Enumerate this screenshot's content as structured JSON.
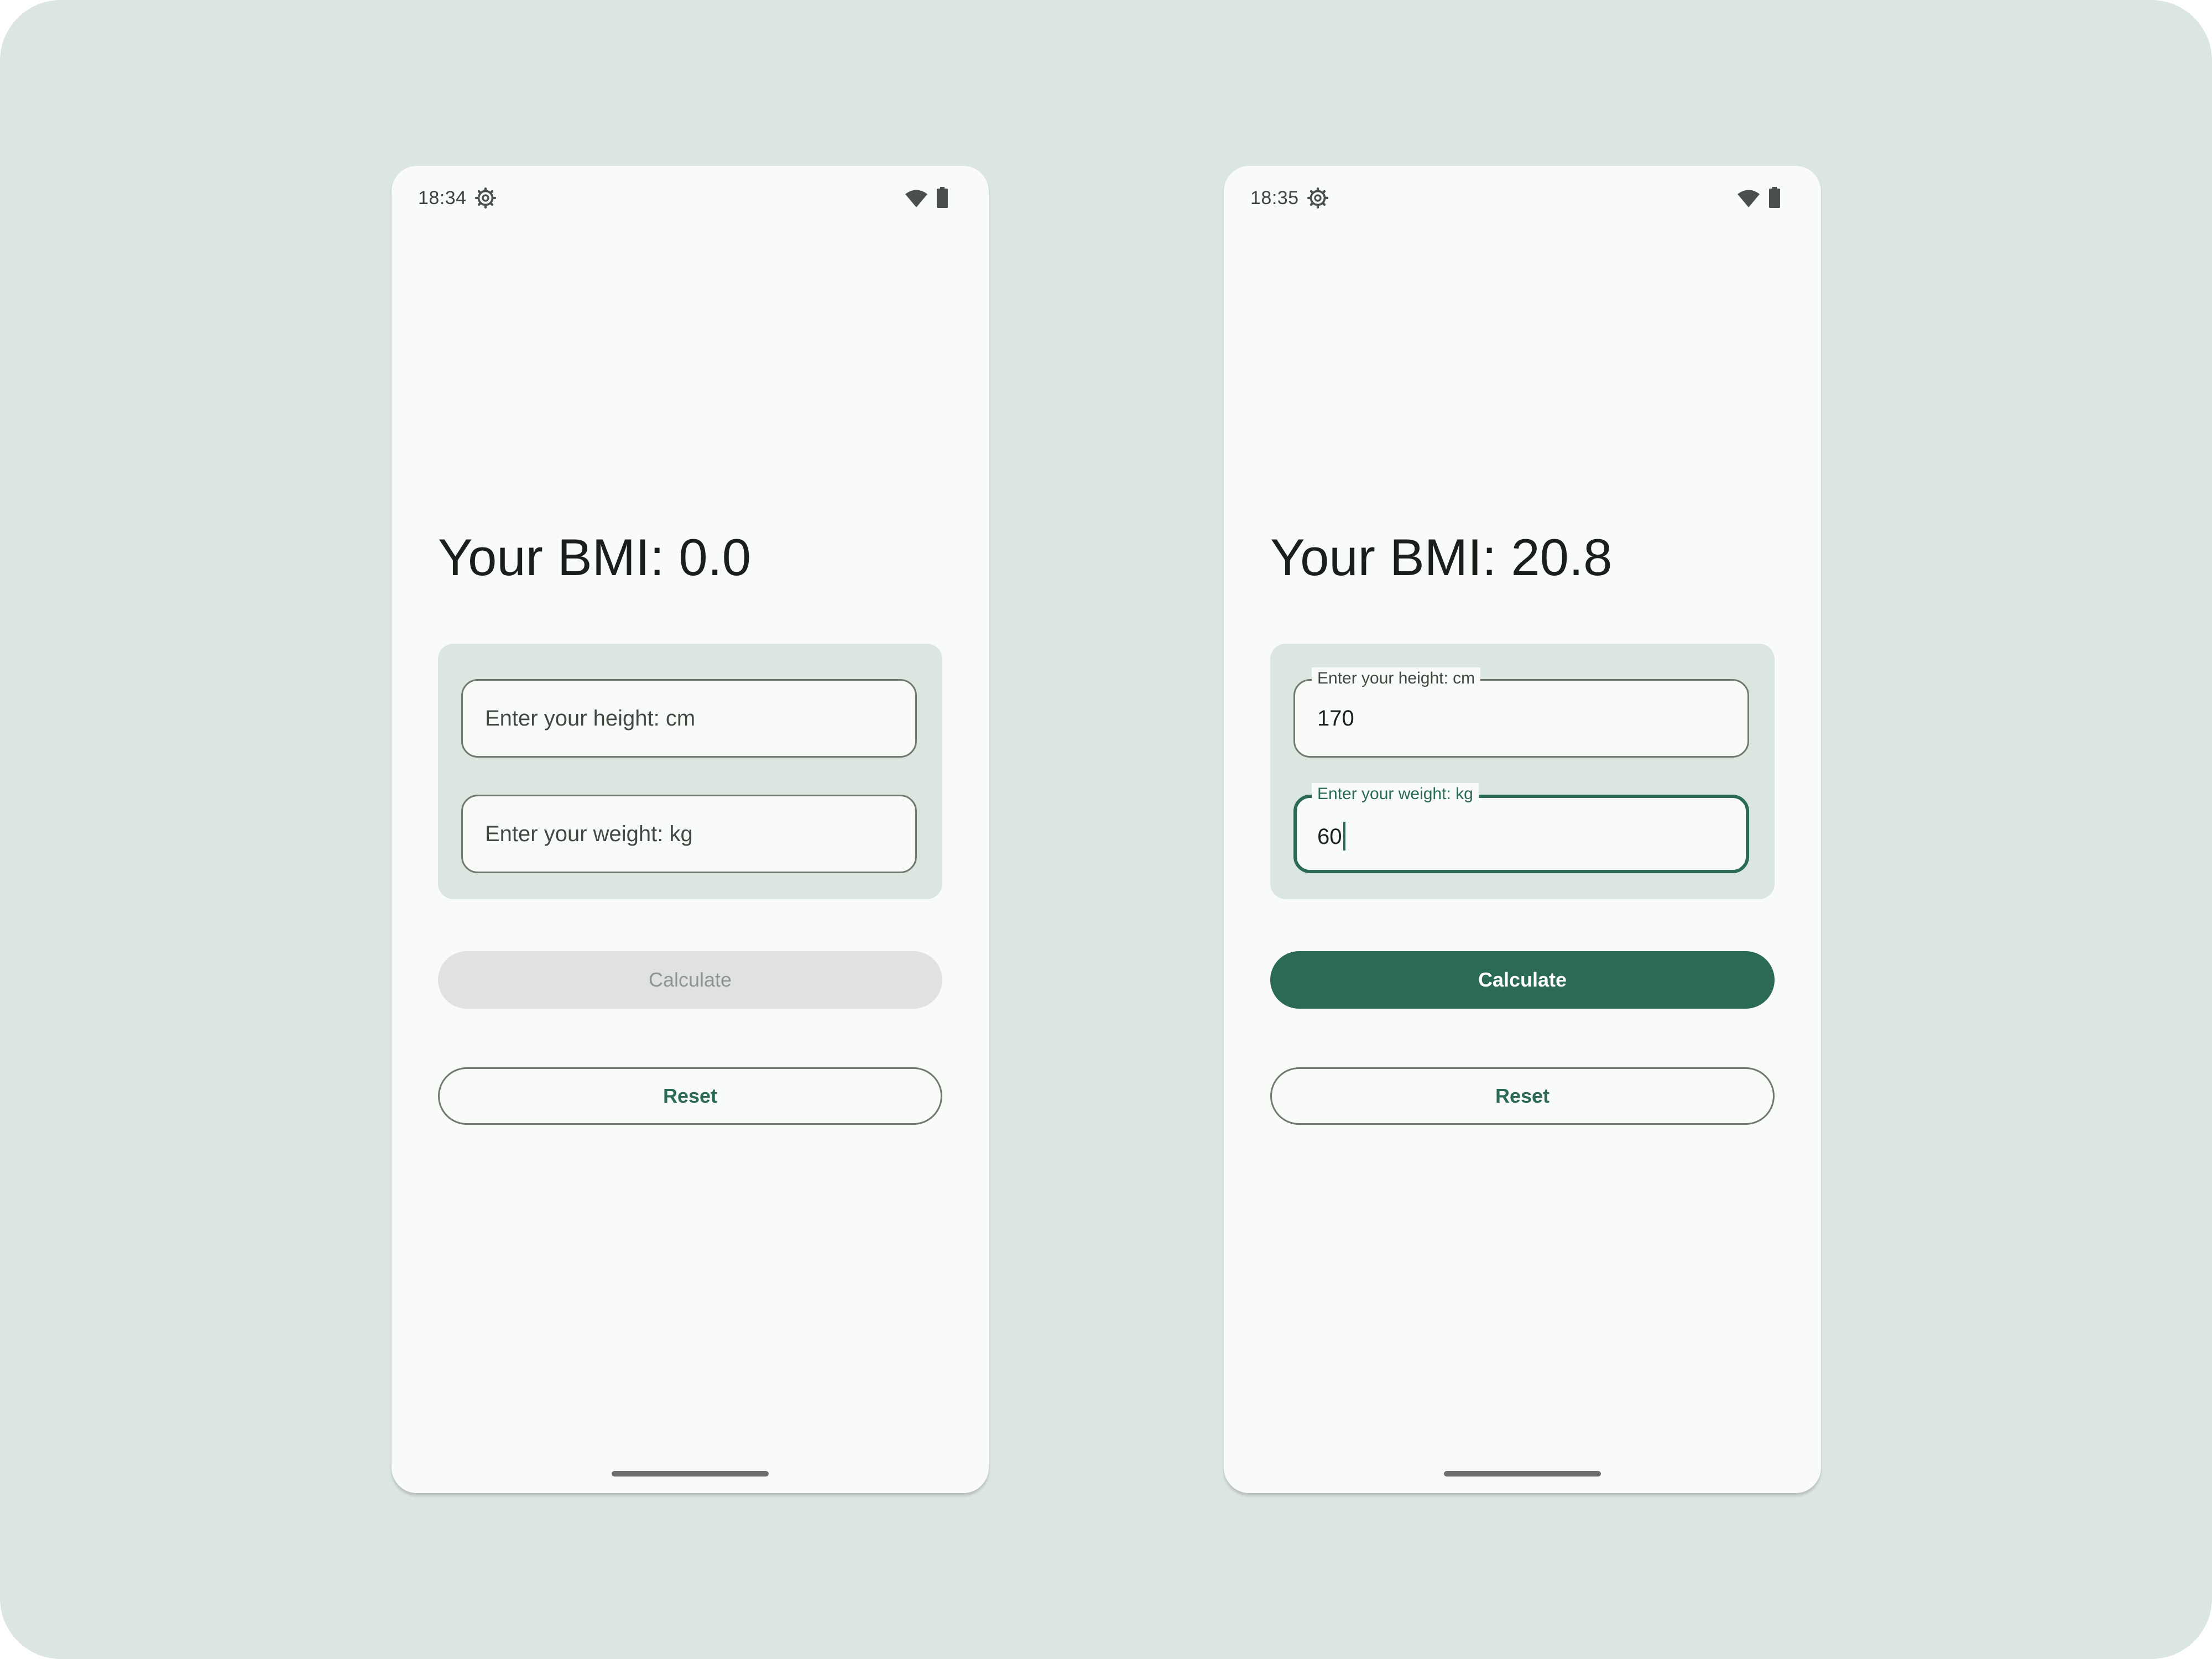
{
  "colors": {
    "background": "#dce6e0",
    "screen": "#f8fbf7",
    "primary": "#2b6a55",
    "disabled_button": "#e0e2e0"
  },
  "screens": [
    {
      "status_bar": {
        "time": "18:34",
        "icons": [
          "settings-icon",
          "wifi-icon",
          "battery-icon"
        ]
      },
      "bmi_text": "Your BMI: 0.0",
      "height_field": {
        "placeholder": "Enter your height: cm",
        "value": ""
      },
      "weight_field": {
        "placeholder": "Enter your weight: kg",
        "value": ""
      },
      "calculate_button": {
        "label": "Calculate",
        "state": "disabled"
      },
      "reset_button": {
        "label": "Reset"
      }
    },
    {
      "status_bar": {
        "time": "18:35",
        "icons": [
          "settings-icon",
          "wifi-icon",
          "battery-icon"
        ]
      },
      "bmi_text": "Your BMI: 20.8",
      "height_field": {
        "label": "Enter your height: cm",
        "value": "170"
      },
      "weight_field": {
        "label": "Enter your weight: kg",
        "value": "60",
        "focused": true
      },
      "calculate_button": {
        "label": "Calculate",
        "state": "enabled"
      },
      "reset_button": {
        "label": "Reset"
      }
    }
  ]
}
